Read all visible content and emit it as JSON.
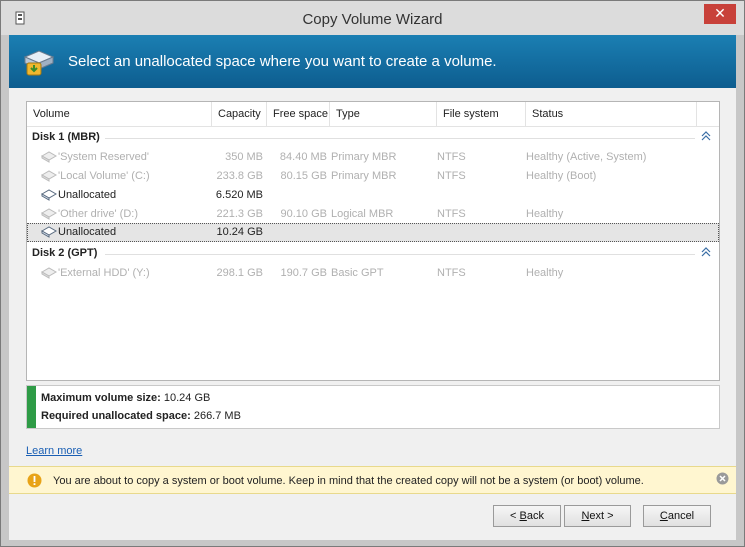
{
  "window": {
    "title": "Copy Volume Wizard",
    "close_glyph": "✕"
  },
  "banner": {
    "text": "Select an unallocated space where you want to create a volume."
  },
  "columns": [
    "Volume",
    "Capacity",
    "Free space",
    "Type",
    "File system",
    "Status"
  ],
  "disks": [
    {
      "label": "Disk 1 (MBR)",
      "volumes": [
        {
          "name": "'System Reserved'",
          "capacity": "350 MB",
          "free": "84.40 MB",
          "type": "Primary MBR",
          "fs": "NTFS",
          "status": "Healthy (Active, System)",
          "enabled": false,
          "selected": false
        },
        {
          "name": "'Local Volume' (C:)",
          "capacity": "233.8 GB",
          "free": "80.15 GB",
          "type": "Primary MBR",
          "fs": "NTFS",
          "status": "Healthy (Boot)",
          "enabled": false,
          "selected": false
        },
        {
          "name": "Unallocated",
          "capacity": "6.520 MB",
          "free": "",
          "type": "",
          "fs": "",
          "status": "",
          "enabled": true,
          "selected": false
        },
        {
          "name": "'Other drive' (D:)",
          "capacity": "221.3 GB",
          "free": "90.10 GB",
          "type": "Logical MBR",
          "fs": "NTFS",
          "status": "Healthy",
          "enabled": false,
          "selected": false
        },
        {
          "name": "Unallocated",
          "capacity": "10.24 GB",
          "free": "",
          "type": "",
          "fs": "",
          "status": "",
          "enabled": true,
          "selected": true
        }
      ]
    },
    {
      "label": "Disk 2 (GPT)",
      "volumes": [
        {
          "name": "'External HDD' (Y:)",
          "capacity": "298.1 GB",
          "free": "190.7 GB",
          "type": "Basic GPT",
          "fs": "NTFS",
          "status": "Healthy",
          "enabled": false,
          "selected": false
        }
      ]
    }
  ],
  "info": {
    "max_label": "Maximum volume size:",
    "max_value": "10.24 GB",
    "req_label": "Required unallocated space:",
    "req_value": "266.7 MB"
  },
  "learn_more": "Learn more",
  "warning": {
    "text": "You are about to copy a system or boot volume. Keep in mind that the created copy will not be a system (or boot) volume."
  },
  "buttons": {
    "back": {
      "pre": "< ",
      "accel": "B",
      "post": "ack"
    },
    "next": {
      "pre": "",
      "accel": "N",
      "post": "ext >"
    },
    "cancel": {
      "pre": "",
      "accel": "C",
      "post": "ancel"
    }
  },
  "colors": {
    "banner": "#1b7fb3",
    "info_bar": "#2e9b46",
    "warning_bg": "#fff6d0",
    "close": "#c8413a"
  }
}
